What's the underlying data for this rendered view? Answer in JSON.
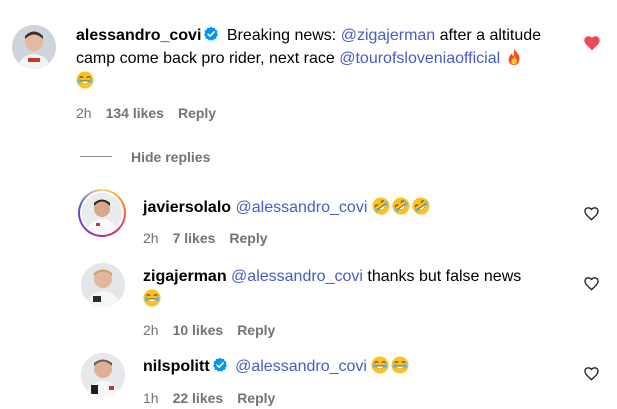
{
  "colors": {
    "mention": "#4a5ac8",
    "meta": "#737373",
    "verified": "#0095f6",
    "heart_liked": "#ed4956"
  },
  "main_comment": {
    "username": "alessandro_covi",
    "verified": true,
    "text_1": "Breaking news:",
    "mention_1": "@zigajerman",
    "text_2": "after a altitude",
    "line2_text": "camp come back pro rider, next race",
    "mention_2": "@tourofsloveniaofficial",
    "emojis": [
      "fire-emoji",
      "joy-emoji"
    ],
    "time": "2h",
    "likes": "134 likes",
    "reply": "Reply",
    "liked": true
  },
  "hide_replies": "Hide replies",
  "replies": [
    {
      "username": "javiersolalo",
      "verified": false,
      "mention": "@alessandro_covi",
      "text": "",
      "emojis": [
        "rofl-emoji",
        "rofl-emoji",
        "rofl-emoji"
      ],
      "time": "2h",
      "likes": "7 likes",
      "reply": "Reply",
      "has_story_ring": true
    },
    {
      "username": "zigajerman",
      "verified": false,
      "mention": "@alessandro_covi",
      "text": "thanks but false news",
      "emojis": [
        "joy-emoji"
      ],
      "time": "2h",
      "likes": "10 likes",
      "reply": "Reply",
      "has_story_ring": false
    },
    {
      "username": "nilspolitt",
      "verified": true,
      "mention": "@alessandro_covi",
      "text": "",
      "emojis": [
        "joy-emoji",
        "joy-emoji"
      ],
      "time": "1h",
      "likes": "22 likes",
      "reply": "Reply",
      "has_story_ring": false
    }
  ]
}
